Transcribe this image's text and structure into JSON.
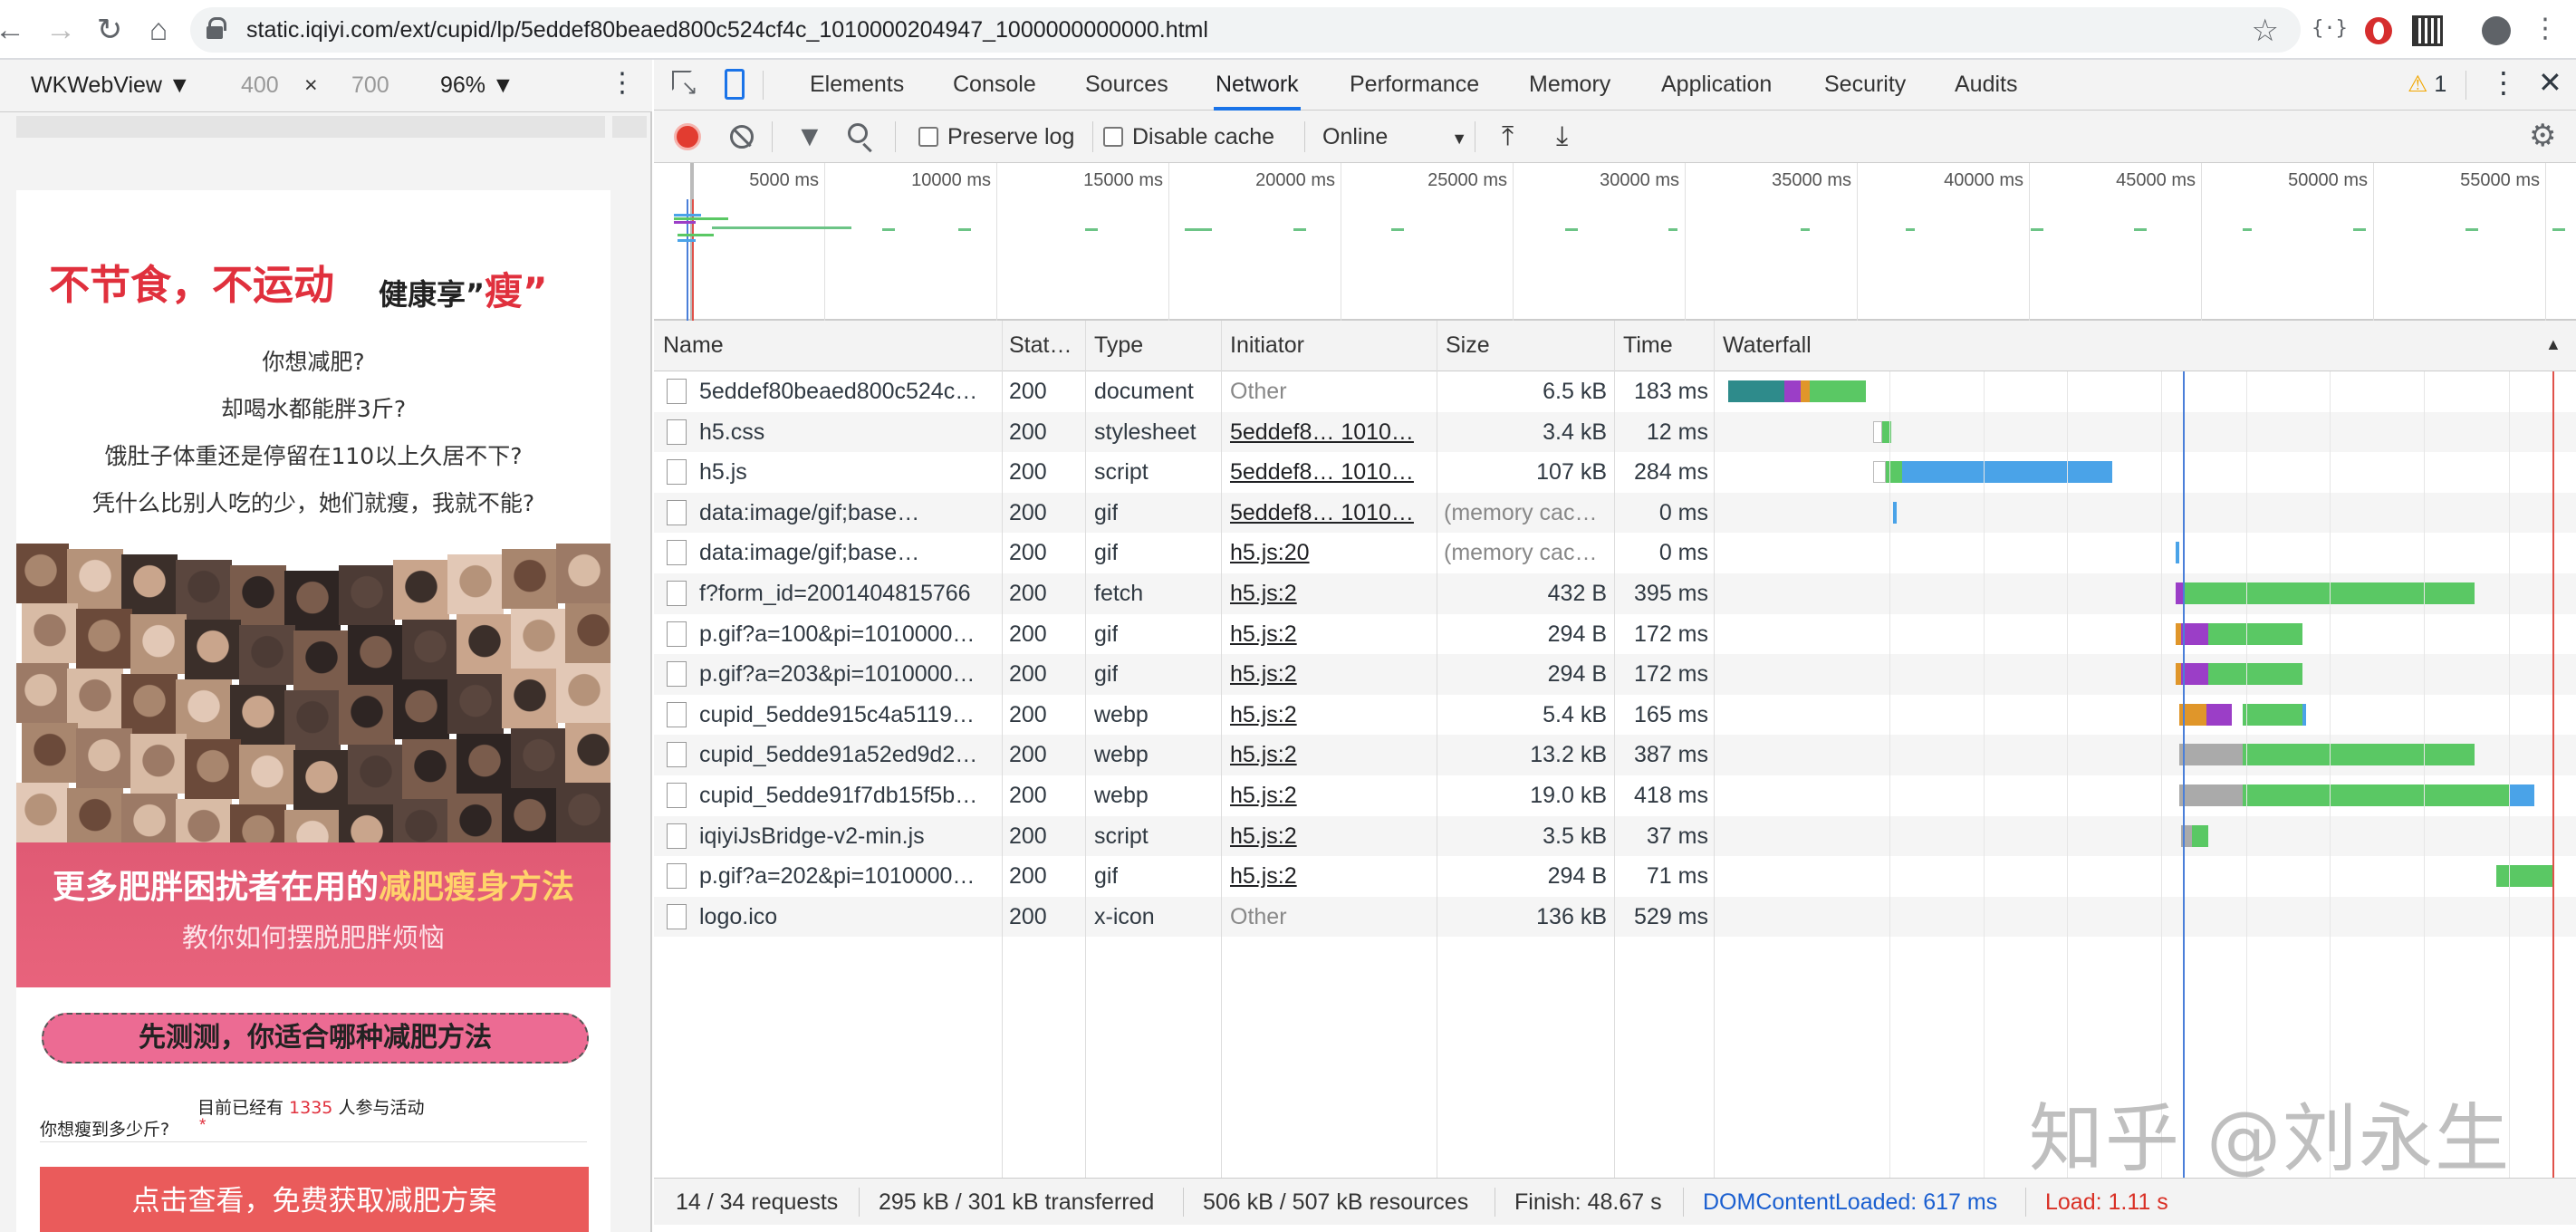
{
  "browser": {
    "url": "static.iqiyi.com/ext/cupid/lp/5eddef80beaed800c524cf4c_1010000204947_1000000000000.html"
  },
  "device_toolbar": {
    "device": "WKWebView",
    "width": "400",
    "times": "×",
    "height": "700",
    "zoom": "96%"
  },
  "page": {
    "title_red": "不节食，不运动",
    "title_black": "健康享”",
    "title_accent": "瘦”",
    "questions": [
      "你想减肥?",
      "却喝水都能胖3斤?",
      "饿肚子体重还是停留在110以上久居不下?",
      "凭什么比别人吃的少，她们就瘦，我就不能?"
    ],
    "band_line1_a": "更多肥胖困扰者在用的",
    "band_line1_b": "减肥瘦身方法",
    "band_line2": "教你如何摆脱肥胖烦恼",
    "test_button": "先测测，你适合哪种减肥方法",
    "count_prefix": "目前已经有 ",
    "count_value": "1335",
    "count_suffix": " 人参与活动",
    "ask_label": "你想瘦到多少斤?",
    "ask_required": "*",
    "cta_button": "点击查看，免费获取减肥方案"
  },
  "devtools": {
    "tabs": [
      "Elements",
      "Console",
      "Sources",
      "Network",
      "Performance",
      "Memory",
      "Application",
      "Security",
      "Audits"
    ],
    "active_tab": "Network",
    "warning_count": "1",
    "toolbar": {
      "preserve_log": "Preserve log",
      "disable_cache": "Disable cache",
      "throttle": "Online"
    },
    "overview_ticks": [
      "5000 ms",
      "10000 ms",
      "15000 ms",
      "20000 ms",
      "25000 ms",
      "30000 ms",
      "35000 ms",
      "40000 ms",
      "45000 ms",
      "50000 ms",
      "55000 ms"
    ],
    "columns": {
      "name": "Name",
      "status": "Stat…",
      "type": "Type",
      "initiator": "Initiator",
      "size": "Size",
      "time": "Time",
      "waterfall": "Waterfall"
    },
    "rows": [
      {
        "name": "5eddef80beaed800c524c…",
        "status": "200",
        "type": "document",
        "initiator": "Other",
        "size": "6.5 kB",
        "time": "183 ms"
      },
      {
        "name": "h5.css",
        "status": "200",
        "type": "stylesheet",
        "initiator": "5eddef8… 1010…",
        "size": "3.4 kB",
        "time": "12 ms"
      },
      {
        "name": "h5.js",
        "status": "200",
        "type": "script",
        "initiator": "5eddef8… 1010…",
        "size": "107 kB",
        "time": "284 ms"
      },
      {
        "name": "data:image/gif;base…",
        "status": "200",
        "type": "gif",
        "initiator": "5eddef8… 1010…",
        "size": "(memory cac…",
        "time": "0 ms"
      },
      {
        "name": "data:image/gif;base…",
        "status": "200",
        "type": "gif",
        "initiator": "h5.js:20",
        "size": "(memory cac…",
        "time": "0 ms"
      },
      {
        "name": "f?form_id=2001404815766",
        "status": "200",
        "type": "fetch",
        "initiator": "h5.js:2",
        "size": "432 B",
        "time": "395 ms"
      },
      {
        "name": "p.gif?a=100&pi=1010000…",
        "status": "200",
        "type": "gif",
        "initiator": "h5.js:2",
        "size": "294 B",
        "time": "172 ms"
      },
      {
        "name": "p.gif?a=203&pi=1010000…",
        "status": "200",
        "type": "gif",
        "initiator": "h5.js:2",
        "size": "294 B",
        "time": "172 ms"
      },
      {
        "name": "cupid_5edde915c4a5119…",
        "status": "200",
        "type": "webp",
        "initiator": "h5.js:2",
        "size": "5.4 kB",
        "time": "165 ms"
      },
      {
        "name": "cupid_5edde91a52ed9d2…",
        "status": "200",
        "type": "webp",
        "initiator": "h5.js:2",
        "size": "13.2 kB",
        "time": "387 ms"
      },
      {
        "name": "cupid_5edde91f7db15f5b…",
        "status": "200",
        "type": "webp",
        "initiator": "h5.js:2",
        "size": "19.0 kB",
        "time": "418 ms"
      },
      {
        "name": "iqiyiJsBridge-v2-min.js",
        "status": "200",
        "type": "script",
        "initiator": "h5.js:2",
        "size": "3.5 kB",
        "time": "37 ms"
      },
      {
        "name": "p.gif?a=202&pi=1010000…",
        "status": "200",
        "type": "gif",
        "initiator": "h5.js:2",
        "size": "294 B",
        "time": "71 ms"
      },
      {
        "name": "logo.ico",
        "status": "200",
        "type": "x-icon",
        "initiator": "Other",
        "size": "136 kB",
        "time": "529 ms"
      }
    ],
    "summary": {
      "requests": "14 / 34 requests",
      "transferred": "295 kB / 301 kB transferred",
      "resources": "506 kB / 507 kB resources",
      "finish": "Finish: 48.67 s",
      "dcl": "DOMContentLoaded: 617 ms",
      "load": "Load: 1.11 s"
    }
  },
  "watermark": "知乎 @刘永生",
  "colors": {
    "accent_blue": "#1a73e8",
    "dcl_blue": "#1a5fd0",
    "load_red": "#d93025",
    "bar_green": "#5ac864",
    "bar_blue": "#4aa3e8",
    "bar_purple": "#9b3ec7"
  }
}
